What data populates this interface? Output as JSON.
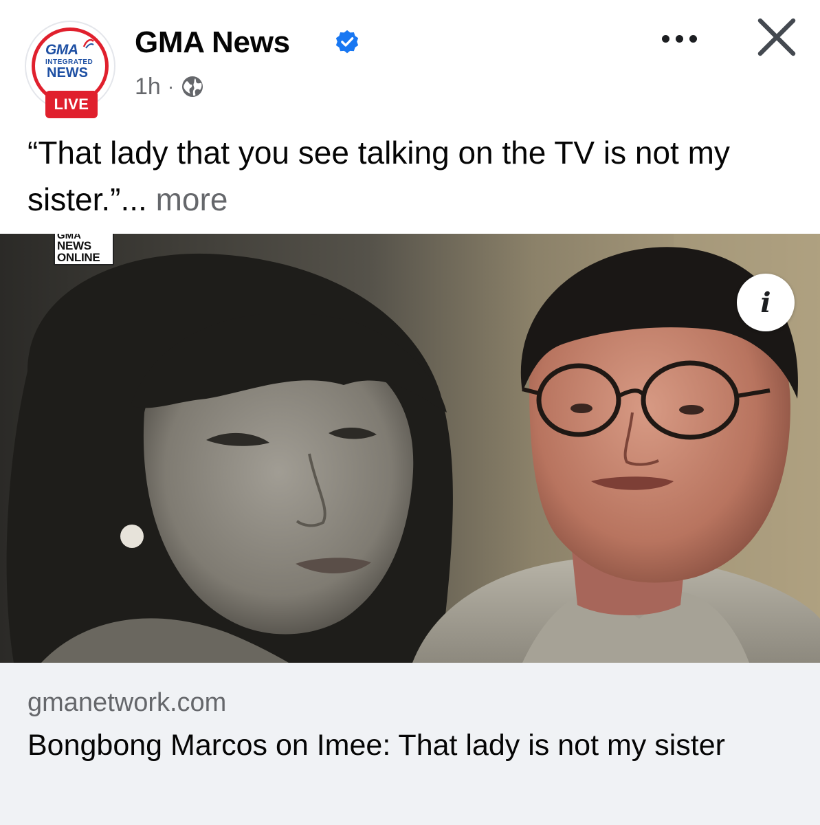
{
  "post": {
    "page_name": "GMA News",
    "time_ago": "1h",
    "separator": "·",
    "caption": "“That lady that you see talking on the TV is not my sister.”...",
    "more_label": "more"
  },
  "avatar": {
    "logo_top": "GMA",
    "logo_middle": "INTEGRATED",
    "logo_bottom": "NEWS",
    "badge": "LIVE"
  },
  "media": {
    "watermark_top": "GMA",
    "watermark_news": "NEWS",
    "watermark_online": "ONLINE",
    "info_label": "i"
  },
  "link": {
    "domain": "gmanetwork.com",
    "title": "Bongbong Marcos on Imee: That lady is not my sister"
  },
  "icons": {
    "verified": "verified-badge-icon",
    "privacy": "globe-icon",
    "more": "more-options-icon",
    "close": "close-icon",
    "info": "info-icon"
  },
  "colors": {
    "brand_red": "#e0202d",
    "brand_blue": "#1d4fa3",
    "verified_blue": "#1877f2",
    "secondary_text": "#65676b",
    "link_card_bg": "#f0f2f5"
  }
}
